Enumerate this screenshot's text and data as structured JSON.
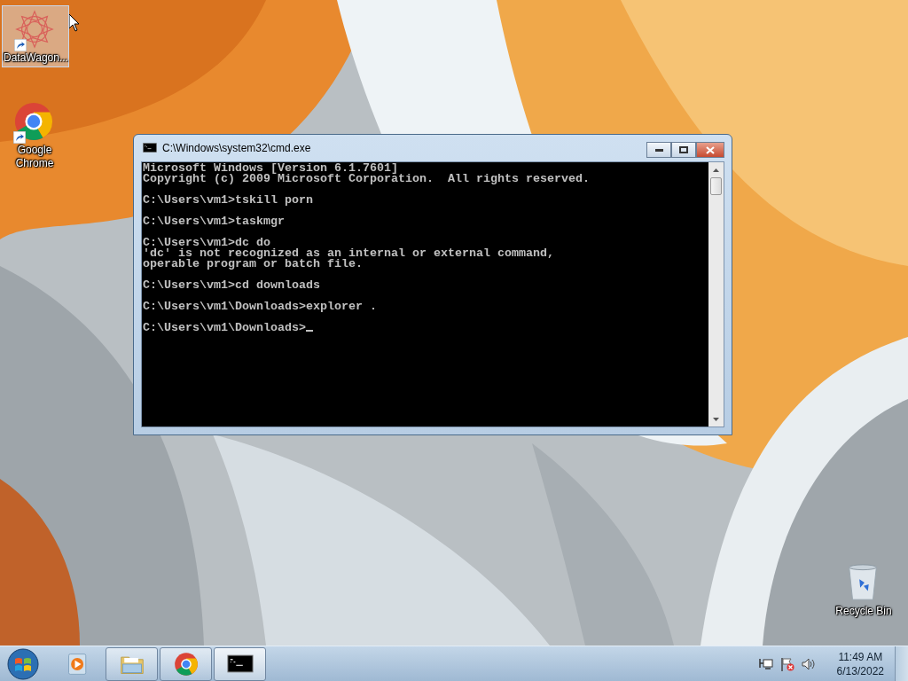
{
  "desktop_icons": [
    {
      "kind": "mandala",
      "label": "DataWagon...",
      "selected": true,
      "shortcut": true
    },
    {
      "kind": "chrome",
      "label": "Google Chrome",
      "selected": false,
      "shortcut": true
    },
    {
      "kind": "recycle",
      "label": "Recycle Bin",
      "selected": false,
      "shortcut": false
    }
  ],
  "window": {
    "title": "C:\\Windows\\system32\\cmd.exe",
    "cursor": true,
    "console_blocks": [
      [
        "Microsoft Windows [Version 6.1.7601]",
        "Copyright (c) 2009 Microsoft Corporation.  All rights reserved."
      ],
      [
        "C:\\Users\\vm1>tskill porn"
      ],
      [
        "C:\\Users\\vm1>taskmgr"
      ],
      [
        "C:\\Users\\vm1>dc do",
        "'dc' is not recognized as an internal or external command,",
        "operable program or batch file."
      ],
      [
        "C:\\Users\\vm1>cd downloads"
      ],
      [
        "C:\\Users\\vm1\\Downloads>explorer ."
      ],
      [
        "C:\\Users\\vm1\\Downloads>"
      ]
    ]
  },
  "taskbar": {
    "items": [
      {
        "kind": "media",
        "open": false,
        "selected": false
      },
      {
        "kind": "folder",
        "open": true,
        "selected": false
      },
      {
        "kind": "chrome",
        "open": true,
        "selected": false
      },
      {
        "kind": "console",
        "open": true,
        "selected": true
      }
    ],
    "clock": {
      "time": "11:49 AM",
      "date": "6/13/2022"
    }
  }
}
